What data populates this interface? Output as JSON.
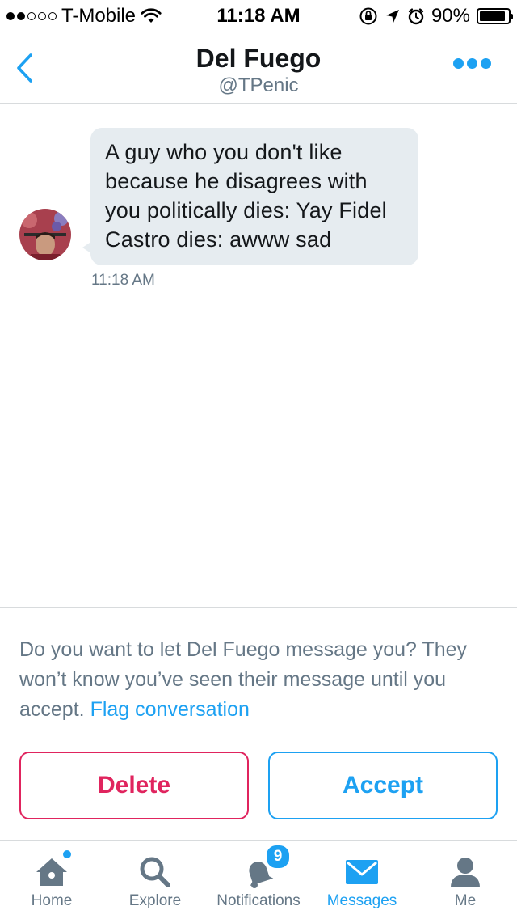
{
  "status_bar": {
    "carrier": "T-Mobile",
    "time": "11:18 AM",
    "battery": "90%",
    "signal_bars_filled": 2,
    "signal_bars_total": 5,
    "battery_level": 0.9
  },
  "header": {
    "title": "Del Fuego",
    "handle": "@TPenic",
    "back_icon": "chevron-left-icon",
    "more_icon": "more-dots-icon"
  },
  "conversation": {
    "messages": [
      {
        "text": "A guy who you don't like because he disagrees with you politically dies: Yay Fidel Castro dies: awww sad",
        "time": "11:18 AM"
      }
    ]
  },
  "request": {
    "prompt": "Do you want to let Del Fuego message you? They won’t know you’ve seen their message until you accept.",
    "flag_label": "Flag conversation",
    "delete_label": "Delete",
    "accept_label": "Accept"
  },
  "tabs": [
    {
      "label": "Home",
      "icon": "home-icon",
      "active": false
    },
    {
      "label": "Explore",
      "icon": "search-icon",
      "active": false
    },
    {
      "label": "Notifications",
      "icon": "bell-icon",
      "active": false,
      "badge": "9"
    },
    {
      "label": "Messages",
      "icon": "envelope-icon",
      "active": true
    },
    {
      "label": "Me",
      "icon": "person-icon",
      "active": false
    }
  ],
  "colors": {
    "accent": "#1da1f2",
    "danger": "#e0245e",
    "bubble": "#e6ecf0",
    "muted_text": "#657786"
  }
}
